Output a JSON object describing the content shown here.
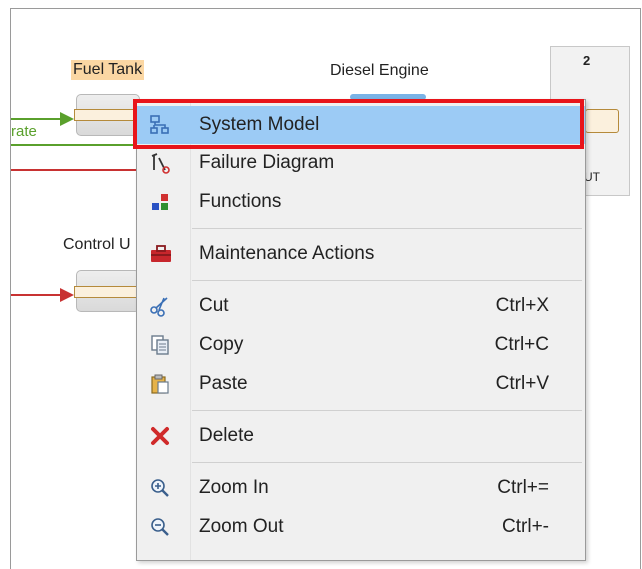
{
  "diagram": {
    "fuel_tank_label": "Fuel Tank",
    "diesel_engine_label": "Diesel Engine",
    "control_unit_label": "Control U",
    "edge_label": "rate",
    "right_block_number": "2",
    "right_block_port": "UT"
  },
  "context_menu": {
    "items": [
      {
        "label": "System Model",
        "shortcut": "",
        "icon": "system-model-icon",
        "selected": true
      },
      {
        "label": "Failure Diagram",
        "shortcut": "",
        "icon": "failure-diagram-icon"
      },
      {
        "label": "Functions",
        "shortcut": "",
        "icon": "functions-icon"
      },
      {
        "label": "Maintenance Actions",
        "shortcut": "",
        "icon": "toolbox-icon"
      },
      {
        "label": "Cut",
        "shortcut": "Ctrl+X",
        "icon": "scissors-icon"
      },
      {
        "label": "Copy",
        "shortcut": "Ctrl+C",
        "icon": "copy-icon"
      },
      {
        "label": "Paste",
        "shortcut": "Ctrl+V",
        "icon": "paste-icon"
      },
      {
        "label": "Delete",
        "shortcut": "",
        "icon": "delete-icon"
      },
      {
        "label": "Zoom In",
        "shortcut": "Ctrl+=",
        "icon": "zoom-in-icon"
      },
      {
        "label": "Zoom Out",
        "shortcut": "Ctrl+-",
        "icon": "zoom-out-icon"
      }
    ]
  },
  "colors": {
    "highlight_outline": "#e8141a",
    "selected_item": "#9ccbf5",
    "flow_green": "#5aa02c",
    "flow_red": "#c83232",
    "fuel_tank_highlight": "#fbd7a3"
  }
}
